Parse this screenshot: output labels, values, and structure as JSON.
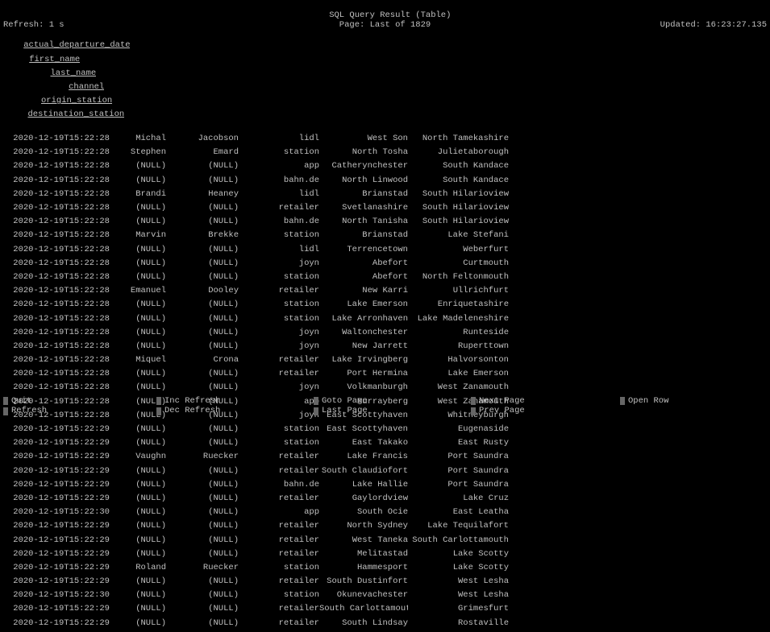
{
  "title": "SQL Query Result (Table)",
  "header": {
    "refresh": "Refresh: 1 s",
    "page": "Page: Last of 1829",
    "updated": "Updated: 16:23:27.135"
  },
  "columns": [
    "actual_departure_date",
    "first_name",
    "last_name",
    "channel",
    "origin_station",
    "destination_station"
  ],
  "rows": [
    [
      "2020-12-19T15:22:28",
      "Michal",
      "Jacobson",
      "lidl",
      "West Son",
      "North Tamekashire"
    ],
    [
      "2020-12-19T15:22:28",
      "Stephen",
      "Emard",
      "station",
      "North Tosha",
      "Julietaborough"
    ],
    [
      "2020-12-19T15:22:28",
      "(NULL)",
      "(NULL)",
      "app",
      "Catherynchester",
      "South Kandace"
    ],
    [
      "2020-12-19T15:22:28",
      "(NULL)",
      "(NULL)",
      "bahn.de",
      "North Linwood",
      "South Kandace"
    ],
    [
      "2020-12-19T15:22:28",
      "Brandi",
      "Heaney",
      "lidl",
      "Brianstad",
      "South Hilarioview"
    ],
    [
      "2020-12-19T15:22:28",
      "(NULL)",
      "(NULL)",
      "retailer",
      "Svetlanashire",
      "South Hilarioview"
    ],
    [
      "2020-12-19T15:22:28",
      "(NULL)",
      "(NULL)",
      "bahn.de",
      "North Tanisha",
      "South Hilarioview"
    ],
    [
      "2020-12-19T15:22:28",
      "Marvin",
      "Brekke",
      "station",
      "Brianstad",
      "Lake Stefani"
    ],
    [
      "2020-12-19T15:22:28",
      "(NULL)",
      "(NULL)",
      "lidl",
      "Terrencetown",
      "Weberfurt"
    ],
    [
      "2020-12-19T15:22:28",
      "(NULL)",
      "(NULL)",
      "joyn",
      "Abefort",
      "Curtmouth"
    ],
    [
      "2020-12-19T15:22:28",
      "(NULL)",
      "(NULL)",
      "station",
      "Abefort",
      "North Feltonmouth"
    ],
    [
      "2020-12-19T15:22:28",
      "Emanuel",
      "Dooley",
      "retailer",
      "New Karri",
      "Ullrichfurt"
    ],
    [
      "2020-12-19T15:22:28",
      "(NULL)",
      "(NULL)",
      "station",
      "Lake Emerson",
      "Enriquetashire"
    ],
    [
      "2020-12-19T15:22:28",
      "(NULL)",
      "(NULL)",
      "station",
      "Lake Arronhaven",
      "Lake Madeleneshire"
    ],
    [
      "2020-12-19T15:22:28",
      "(NULL)",
      "(NULL)",
      "joyn",
      "Waltonchester",
      "Runteside"
    ],
    [
      "2020-12-19T15:22:28",
      "(NULL)",
      "(NULL)",
      "joyn",
      "New Jarrett",
      "Ruperttown"
    ],
    [
      "2020-12-19T15:22:28",
      "Miquel",
      "Crona",
      "retailer",
      "Lake Irvingberg",
      "Halvorsonton"
    ],
    [
      "2020-12-19T15:22:28",
      "(NULL)",
      "(NULL)",
      "retailer",
      "Port Hermina",
      "Lake Emerson"
    ],
    [
      "2020-12-19T15:22:28",
      "(NULL)",
      "(NULL)",
      "joyn",
      "Volkmanburgh",
      "West Zanamouth"
    ],
    [
      "2020-12-19T15:22:28",
      "(NULL)",
      "(NULL)",
      "app",
      "Murrayberg",
      "West Zanamouth"
    ],
    [
      "2020-12-19T15:22:28",
      "(NULL)",
      "(NULL)",
      "joyn",
      "East Scottyhaven",
      "Whitneyburgh"
    ],
    [
      "2020-12-19T15:22:29",
      "(NULL)",
      "(NULL)",
      "station",
      "East Scottyhaven",
      "Eugenaside"
    ],
    [
      "2020-12-19T15:22:29",
      "(NULL)",
      "(NULL)",
      "station",
      "East Takako",
      "East Rusty"
    ],
    [
      "2020-12-19T15:22:29",
      "Vaughn",
      "Ruecker",
      "retailer",
      "Lake Francis",
      "Port Saundra"
    ],
    [
      "2020-12-19T15:22:29",
      "(NULL)",
      "(NULL)",
      "retailer",
      "South Claudiofort",
      "Port Saundra"
    ],
    [
      "2020-12-19T15:22:29",
      "(NULL)",
      "(NULL)",
      "bahn.de",
      "Lake Hallie",
      "Port Saundra"
    ],
    [
      "2020-12-19T15:22:29",
      "(NULL)",
      "(NULL)",
      "retailer",
      "Gaylordview",
      "Lake Cruz"
    ],
    [
      "2020-12-19T15:22:30",
      "(NULL)",
      "(NULL)",
      "app",
      "South Ocie",
      "East Leatha"
    ],
    [
      "2020-12-19T15:22:29",
      "(NULL)",
      "(NULL)",
      "retailer",
      "North Sydney",
      "Lake Tequilafort"
    ],
    [
      "2020-12-19T15:22:29",
      "(NULL)",
      "(NULL)",
      "retailer",
      "West Taneka",
      "South Carlottamouth"
    ],
    [
      "2020-12-19T15:22:29",
      "(NULL)",
      "(NULL)",
      "retailer",
      "Melitastad",
      "Lake Scotty"
    ],
    [
      "2020-12-19T15:22:29",
      "Roland",
      "Ruecker",
      "station",
      "Hammesport",
      "Lake Scotty"
    ],
    [
      "2020-12-19T15:22:29",
      "(NULL)",
      "(NULL)",
      "retailer",
      "South Dustinfort",
      "West Lesha"
    ],
    [
      "2020-12-19T15:22:30",
      "(NULL)",
      "(NULL)",
      "station",
      "Okunevachester",
      "West Lesha"
    ],
    [
      "2020-12-19T15:22:29",
      "(NULL)",
      "(NULL)",
      "retailer",
      "South Carlottamouth",
      "Grimesfurt"
    ],
    [
      "2020-12-19T15:22:29",
      "(NULL)",
      "(NULL)",
      "retailer",
      "South Lindsay",
      "Rostaville"
    ]
  ],
  "footer": {
    "row1": [
      "Quit",
      "Inc Refresh",
      "Goto Page",
      "Next Page",
      "Open Row"
    ],
    "row2": [
      "Refresh",
      "Dec Refresh",
      "Last Page",
      "Prev Page",
      ""
    ]
  }
}
